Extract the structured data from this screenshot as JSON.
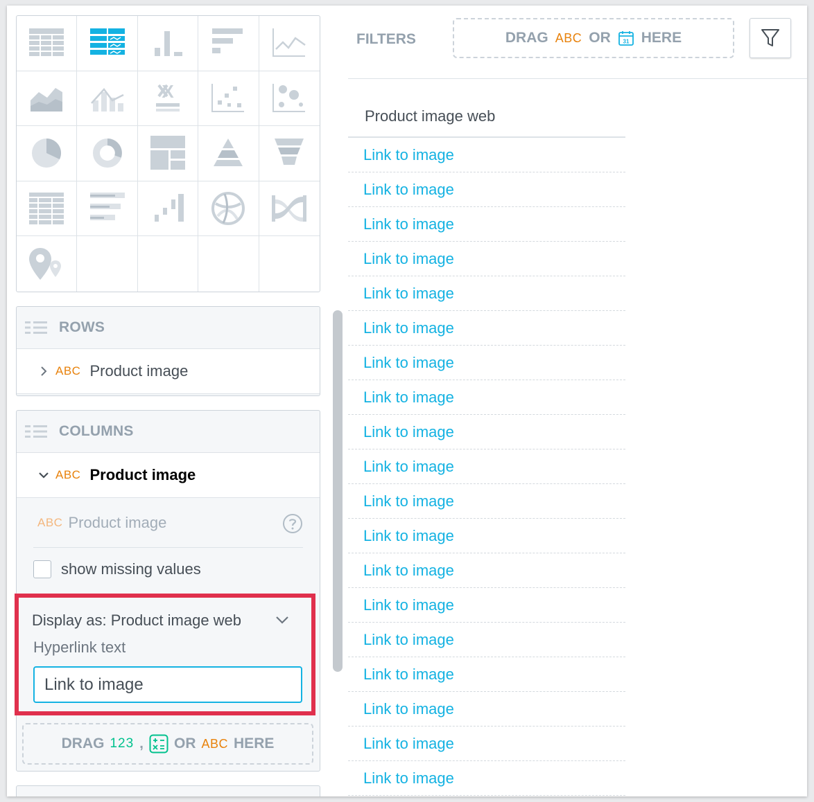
{
  "viz_types": [
    {
      "name": "table-icon"
    },
    {
      "name": "headline-icon"
    },
    {
      "name": "column-chart-icon"
    },
    {
      "name": "bar-chart-icon"
    },
    {
      "name": "line-chart-icon"
    },
    {
      "name": "area-chart-icon"
    },
    {
      "name": "combo-chart-icon"
    },
    {
      "name": "headline-x-icon"
    },
    {
      "name": "scatter-plot-icon"
    },
    {
      "name": "bubble-chart-icon"
    },
    {
      "name": "pie-chart-icon"
    },
    {
      "name": "donut-chart-icon"
    },
    {
      "name": "treemap-icon"
    },
    {
      "name": "pyramid-chart-icon"
    },
    {
      "name": "funnel-chart-icon"
    },
    {
      "name": "heatmap-icon"
    },
    {
      "name": "bullet-chart-icon"
    },
    {
      "name": "waterfall-chart-icon"
    },
    {
      "name": "dependency-wheel-icon"
    },
    {
      "name": "sankey-chart-icon"
    },
    {
      "name": "geo-pushpin-icon"
    },
    {
      "name": "empty"
    },
    {
      "name": "empty"
    },
    {
      "name": "empty"
    },
    {
      "name": "empty"
    }
  ],
  "rows": {
    "title": "ROWS",
    "item": {
      "type_label": "ABC",
      "name": "Product image"
    }
  },
  "columns": {
    "title": "COLUMNS",
    "item": {
      "type_label": "ABC",
      "name": "Product image"
    },
    "attribute": {
      "type_label": "ABC",
      "name": "Product image"
    },
    "show_missing_label": "show missing values",
    "display_as": "Display as: Product image web",
    "hyperlink_label": "Hyperlink text",
    "hyperlink_value": "Link to image"
  },
  "drop_zone": {
    "drag": "DRAG",
    "num": "123",
    "comma": ",",
    "or": "OR",
    "abc": "ABC",
    "here": "HERE"
  },
  "filters": {
    "label": "FILTERS",
    "drag": "DRAG",
    "abc": "ABC",
    "or": "OR",
    "here": "HERE"
  },
  "table": {
    "header": "Product image web",
    "rows": [
      "Link to image",
      "Link to image",
      "Link to image",
      "Link to image",
      "Link to image",
      "Link to image",
      "Link to image",
      "Link to image",
      "Link to image",
      "Link to image",
      "Link to image",
      "Link to image",
      "Link to image",
      "Link to image",
      "Link to image",
      "Link to image",
      "Link to image",
      "Link to image",
      "Link to image"
    ]
  },
  "colors": {
    "accent": "#14b2e2",
    "attribute": "#e8820c",
    "metric": "#00c18d",
    "highlight": "#e0304d",
    "icon_gray": "#c9d1d8"
  }
}
